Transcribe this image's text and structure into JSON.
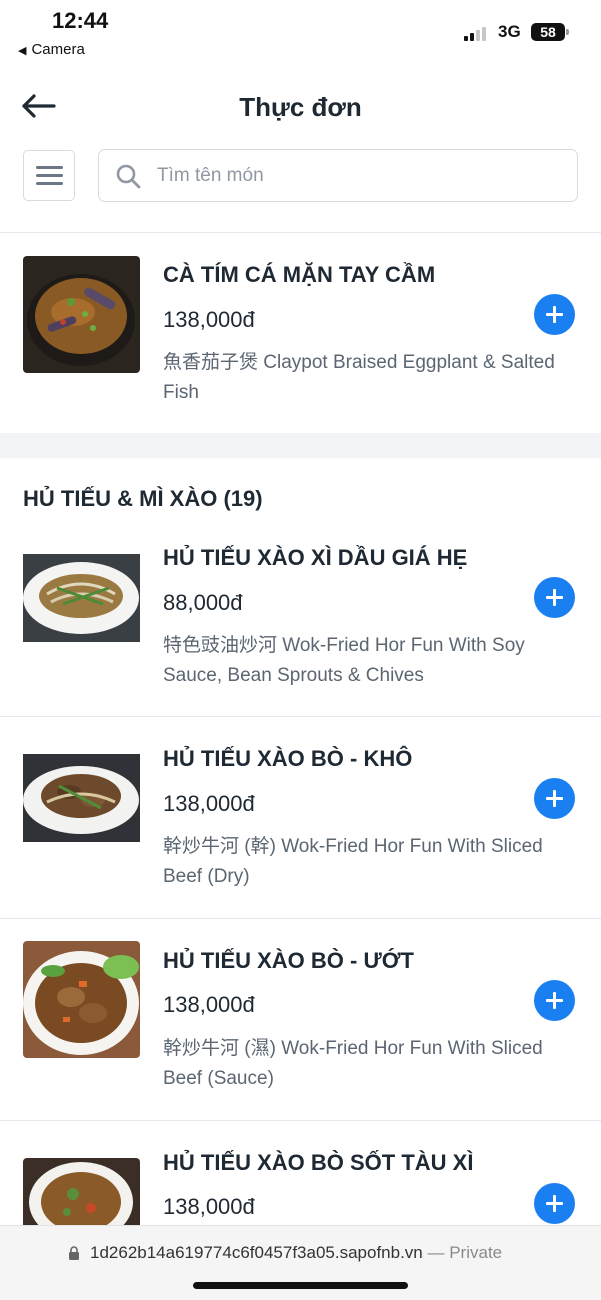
{
  "status_bar": {
    "time": "12:44",
    "back_app": "Camera",
    "network": "3G",
    "battery": "58"
  },
  "header": {
    "title": "Thực đơn"
  },
  "search": {
    "placeholder": "Tìm tên món"
  },
  "featured_item": {
    "name": "CÀ TÍM CÁ MẶN TAY CẦM",
    "price": "138,000đ",
    "description": "魚香茄子煲 Claypot Braised Eggplant & Salted Fish"
  },
  "section": {
    "title": "HỦ TIẾU & MÌ XÀO (19)",
    "items": [
      {
        "name": "HỦ TIẾU XÀO XÌ DẦU GIÁ HẸ",
        "price": "88,000đ",
        "description": "特色豉油炒河 Wok-Fried Hor Fun With Soy Sauce, Bean Sprouts & Chives"
      },
      {
        "name": "HỦ TIẾU XÀO BÒ - KHÔ",
        "price": "138,000đ",
        "description": "幹炒牛河 (幹) Wok-Fried Hor Fun With Sliced Beef (Dry)"
      },
      {
        "name": "HỦ TIẾU XÀO BÒ - ƯỚT",
        "price": "138,000đ",
        "description": "幹炒牛河 (濕) Wok-Fried Hor Fun With Sliced Beef (Sauce)"
      },
      {
        "name": "HỦ TIẾU XÀO BÒ SỐT TÀU XÌ",
        "price": "138,000đ",
        "description": ""
      }
    ]
  },
  "browser": {
    "url": "1d262b14a619774c6f0457f3a05.sapofnb.vn",
    "privacy": " — Private"
  },
  "colors": {
    "accent": "#1a7ff0",
    "text": "#1f2933",
    "muted": "#5b6672",
    "section_bg": "#f3f4f6"
  }
}
